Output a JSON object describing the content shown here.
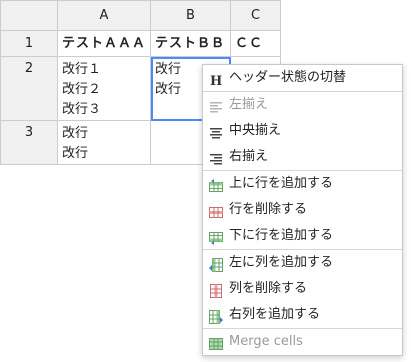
{
  "grid": {
    "columns": [
      "A",
      "B",
      "C"
    ],
    "rows": [
      {
        "header": "1",
        "cells": [
          "テストＡＡＡ",
          "テストＢＢ",
          "ＣＣ"
        ]
      },
      {
        "header": "2",
        "cells": [
          [
            "改行１",
            "改行２",
            "改行３"
          ],
          [
            "改行",
            "改行"
          ],
          []
        ]
      },
      {
        "header": "3",
        "cells": [
          [
            "改行",
            "改行"
          ],
          [],
          []
        ]
      }
    ]
  },
  "context_menu": {
    "items": [
      {
        "label": "ヘッダー状態の切替",
        "icon": "header-h-icon",
        "enabled": true
      },
      {
        "label": "左揃え",
        "icon": "align-left-icon",
        "enabled": false
      },
      {
        "label": "中央揃え",
        "icon": "align-center-icon",
        "enabled": true
      },
      {
        "label": "右揃え",
        "icon": "align-right-icon",
        "enabled": true
      },
      {
        "label": "上に行を追加する",
        "icon": "row-add-above-icon",
        "enabled": true
      },
      {
        "label": "行を削除する",
        "icon": "row-delete-icon",
        "enabled": true
      },
      {
        "label": "下に行を追加する",
        "icon": "row-add-below-icon",
        "enabled": true
      },
      {
        "label": "左に列を追加する",
        "icon": "col-add-left-icon",
        "enabled": true
      },
      {
        "label": "列を削除する",
        "icon": "col-delete-icon",
        "enabled": true
      },
      {
        "label": "右列を追加する",
        "icon": "col-add-right-icon",
        "enabled": true
      },
      {
        "label": "Merge cells",
        "icon": "merge-cells-icon",
        "enabled": false
      }
    ]
  },
  "colors": {
    "selection": "#4b89ff",
    "header_bg": "#f0f0f0",
    "green": "#5cb85c",
    "red": "#e05252"
  }
}
